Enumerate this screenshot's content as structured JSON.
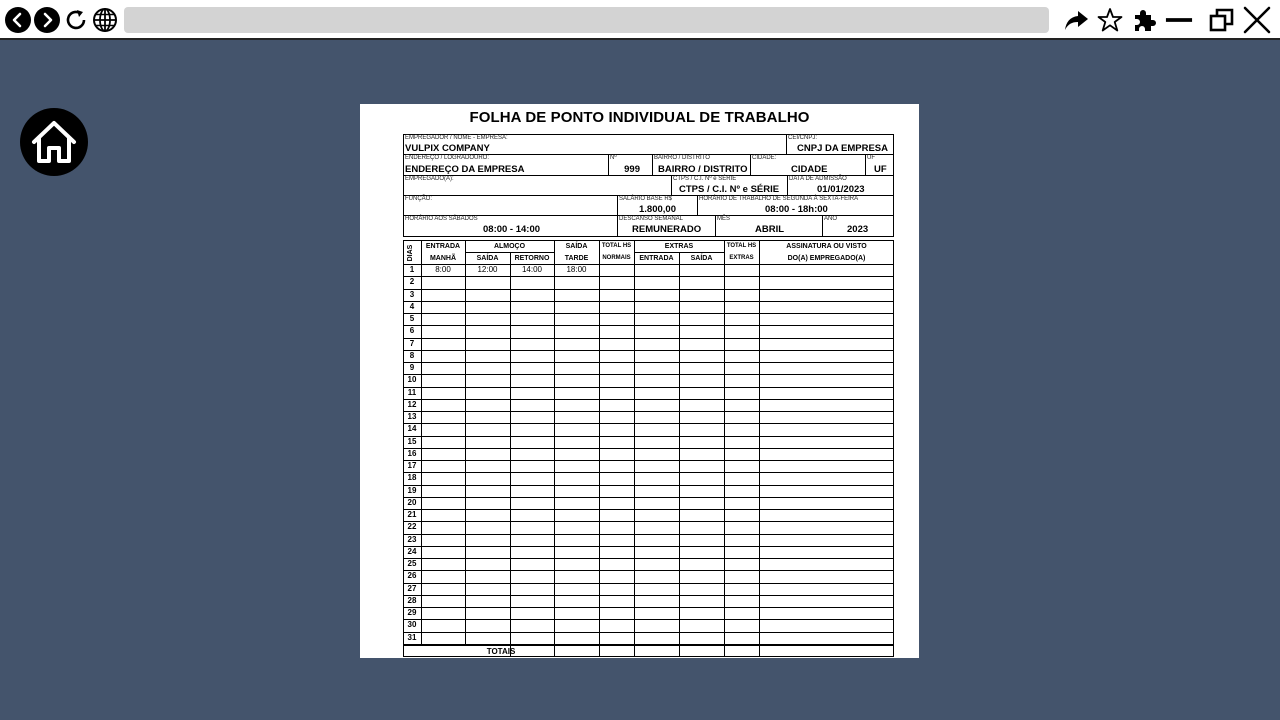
{
  "browser": {
    "url": "",
    "icons": [
      "back-icon",
      "forward-icon",
      "reload-icon",
      "globe-icon",
      "share-icon",
      "star-icon",
      "puzzle-icon",
      "minimize-icon",
      "restore-icon",
      "close-icon"
    ]
  },
  "home": {
    "icon": "home-icon"
  },
  "colors": {
    "background": "#44546c",
    "urlbar": "#d3d3d3"
  },
  "sheet": {
    "title": "FOLHA DE PONTO INDIVIDUAL DE TRABALHO",
    "employer_label": "EMPREGADOR / NOME - EMPRESA:",
    "employer_value": "VULPIX COMPANY",
    "cnpj_label": "CEI/CNPJ:",
    "cnpj_value": "CNPJ DA EMPRESA",
    "address_label": "ENDEREÇO / LOGRADOURO:",
    "address_value": "ENDEREÇO DA EMPRESA",
    "number_label": "Nº",
    "number_value": "999",
    "district_label": "BAIRRO / DISTRITO",
    "district_value": "BAIRRO / DISTRITO",
    "city_label": "CIDADE:",
    "city_value": "CIDADE",
    "uf_label": "UF",
    "uf_value": "UF",
    "employee_label": "EMPREGADO(A):",
    "employee_value": "",
    "ctps_label": "CTPS / C.I. Nº e SÉRIE",
    "ctps_value": "CTPS / C.I. Nº e SÉRIE",
    "admission_label": "DATA DE ADMISSÃO",
    "admission_value": "01/01/2023",
    "role_label": "FUNÇÃO:",
    "role_value": "",
    "salary_label": "SALÁRIO BASE R$",
    "salary_value": "1.800,00",
    "weekday_hours_label": "HORÁRIO DE TRABALHO DE SEGUNDA À SEXTA-FEIRA",
    "weekday_hours_value": "08:00 - 18h:00",
    "saturday_label": "HORÁRIO AOS SÁBADOS",
    "saturday_value": "08:00 - 14:00",
    "rest_label": "DESCANSO SEMANAL",
    "rest_value": "REMUNERADO",
    "month_label": "MÊS",
    "month_value": "ABRIL",
    "year_label": "ANO",
    "year_value": "2023",
    "table": {
      "days_header": "DIAS",
      "entrada_top": "ENTRADA",
      "entrada_bottom": "MANHÃ",
      "almoco": "ALMOÇO",
      "almoco_saida": "SAÍDA",
      "almoco_retorno": "RETORNO",
      "saida_top": "SAÍDA",
      "saida_bottom": "TARDE",
      "total_top": "TOTAL HS",
      "total_bottom": "NORMAIS",
      "extras": "EXTRAS",
      "extras_entrada": "ENTRADA",
      "extras_saida": "SAÍDA",
      "total_extras_top": "TOTAL HS",
      "total_extras_bottom": "EXTRAS",
      "signature_top": "ASSINATURA OU VISTO",
      "signature_bottom": "DO(A) EMPREGADO(A)",
      "totals_label": "TOTAIS",
      "rows": [
        {
          "day": "1",
          "entrada": "8:00",
          "saida_almoco": "12:00",
          "retorno": "14:00",
          "saida_tarde": "18:00"
        },
        {
          "day": "2"
        },
        {
          "day": "3"
        },
        {
          "day": "4"
        },
        {
          "day": "5"
        },
        {
          "day": "6"
        },
        {
          "day": "7"
        },
        {
          "day": "8"
        },
        {
          "day": "9"
        },
        {
          "day": "10"
        },
        {
          "day": "11"
        },
        {
          "day": "12"
        },
        {
          "day": "13"
        },
        {
          "day": "14"
        },
        {
          "day": "15"
        },
        {
          "day": "16"
        },
        {
          "day": "17"
        },
        {
          "day": "18"
        },
        {
          "day": "19"
        },
        {
          "day": "20"
        },
        {
          "day": "21"
        },
        {
          "day": "22"
        },
        {
          "day": "23"
        },
        {
          "day": "24"
        },
        {
          "day": "25"
        },
        {
          "day": "26"
        },
        {
          "day": "27"
        },
        {
          "day": "28"
        },
        {
          "day": "29"
        },
        {
          "day": "30"
        },
        {
          "day": "31"
        }
      ]
    }
  }
}
